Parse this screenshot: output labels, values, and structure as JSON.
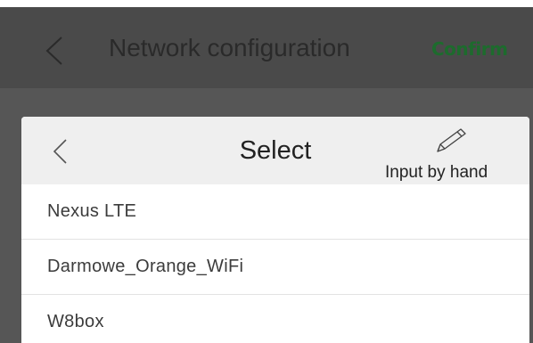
{
  "top_bar": {
    "title": "Network configuration",
    "confirm_label": "Confirm",
    "back_icon": "chevron-left-icon"
  },
  "dialog": {
    "title": "Select",
    "back_icon": "chevron-left-icon",
    "input_by_hand_icon": "pencil-icon",
    "input_by_hand_label": "Input by hand",
    "networks": [
      {
        "name": "Nexus LTE"
      },
      {
        "name": "Darmowe_Orange_WiFi"
      },
      {
        "name": "W8box"
      }
    ]
  },
  "colors": {
    "top_bar": "#4a4a4a",
    "backdrop": "#565656",
    "confirm": "#1d6b2d",
    "sheet_header": "#efefef"
  }
}
